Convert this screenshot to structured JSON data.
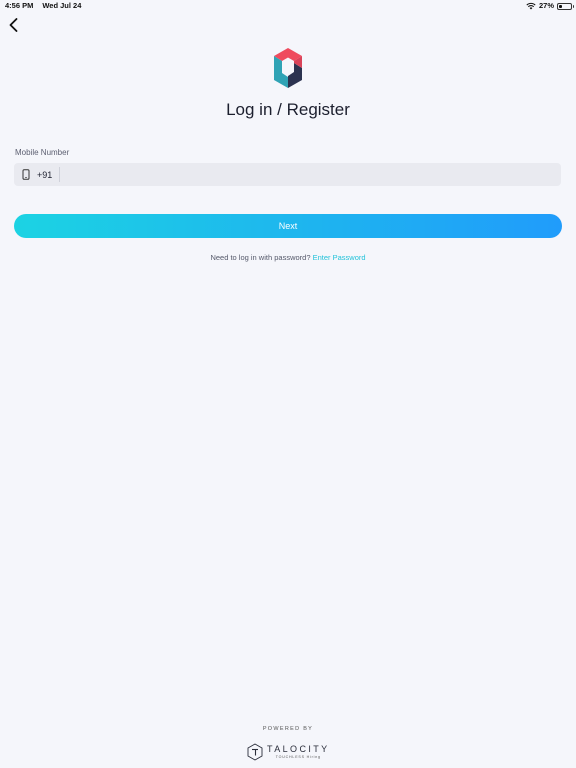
{
  "status_bar": {
    "time": "4:56 PM",
    "date": "Wed Jul 24",
    "battery": "27%",
    "battery_level": 0.27,
    "wifi_icon": "wifi-icon",
    "battery_icon": "battery-icon"
  },
  "nav": {
    "back_icon": "chevron-left-icon"
  },
  "header": {
    "logo_icon": "cube-logo-icon",
    "title": "Log in / Register"
  },
  "form": {
    "mobile_label": "Mobile Number",
    "phone_icon": "mobile-phone-icon",
    "country_code": "+91",
    "phone_value": "",
    "phone_placeholder": "",
    "next_label": "Next"
  },
  "password_prompt": {
    "text": "Need to log in with password?",
    "link": "Enter Password"
  },
  "footer": {
    "powered_by": "POWERED BY",
    "brand_name": "TALOCITY",
    "brand_tagline": "TOUCHLESS Hiring"
  },
  "colors": {
    "background": "#f5f6fb",
    "accent": "#22c2d9",
    "button_gradient_start": "#1cd3e3",
    "button_gradient_end": "#209cfb",
    "logo_red": "#ef4b5e",
    "logo_teal": "#2fa3b5",
    "logo_navy": "#2c3350"
  }
}
